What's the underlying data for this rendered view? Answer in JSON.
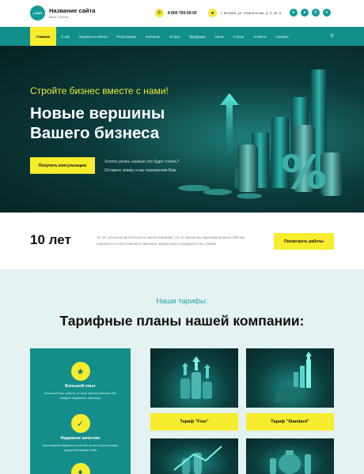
{
  "header": {
    "logo_text": "LOGO",
    "site_title": "Название сайта",
    "site_slogan": "Ваш слоган",
    "phone": "8 800 700-00-00",
    "address": "г. Москва, ул. Ломоносова, д. 4, кв. 5",
    "phone_icon": "phone-icon",
    "geo_icon": "location-icon",
    "socials": [
      {
        "name": "telegram",
        "glyph": "➤"
      },
      {
        "name": "vk",
        "glyph": "в"
      },
      {
        "name": "whatsapp",
        "glyph": "✆"
      },
      {
        "name": "telegram-alt",
        "glyph": "✈"
      }
    ]
  },
  "nav": {
    "items": [
      "Главная",
      "О нас",
      "Вопросы и ответы",
      "Регистрация",
      "Контакты",
      "Услуги",
      "Продукция",
      "Цены",
      "Статьи",
      "Новости",
      "Галерея"
    ],
    "search_icon": "search-icon"
  },
  "hero": {
    "subtitle": "Стройте бизнес вместе с нами!",
    "title": "Новые вершины Вашего бизнеса",
    "button": "Получить консультацию",
    "note_line1": "Хотите узнать сколько это будет стоить?",
    "note_line2": "Оставьте заявку и мы перезвоним Вам",
    "percent_symbol": "%"
  },
  "years": {
    "number": "10 лет",
    "text": "10 лет успешной деятельности нашей компании. За это время мы зарекомендовали себя как надежного и ответственного партнера. Будем рады сотрудничеству с Вами!",
    "button": "Посмотреть работы"
  },
  "tariffs": {
    "pre_title": "Наши тарифы:",
    "title": "Тарифные планы нашей компании:",
    "features": [
      {
        "icon": "award-icon",
        "glyph": "★",
        "title": "Большой опыт",
        "text": "Большой опыт работы. В лице нашей компании Вы найдете надежного партнера"
      },
      {
        "icon": "badge-icon",
        "glyph": "✓",
        "title": "Надежное качество",
        "text": "Гарантируем надежное качество на все услуги/товары предоставляемые нами"
      },
      {
        "icon": "shield-icon",
        "glyph": "♦",
        "title": "",
        "text": ""
      }
    ],
    "cards": [
      {
        "label": "Тариф \"Free\""
      },
      {
        "label": "Тариф \"Standard\""
      },
      {
        "label": ""
      },
      {
        "label": ""
      }
    ]
  },
  "colors": {
    "accent_yellow": "#f7ec2e",
    "brand_teal": "#128e8b",
    "hero_dark": "#062222",
    "tariff_bg": "#e4f2f2"
  }
}
